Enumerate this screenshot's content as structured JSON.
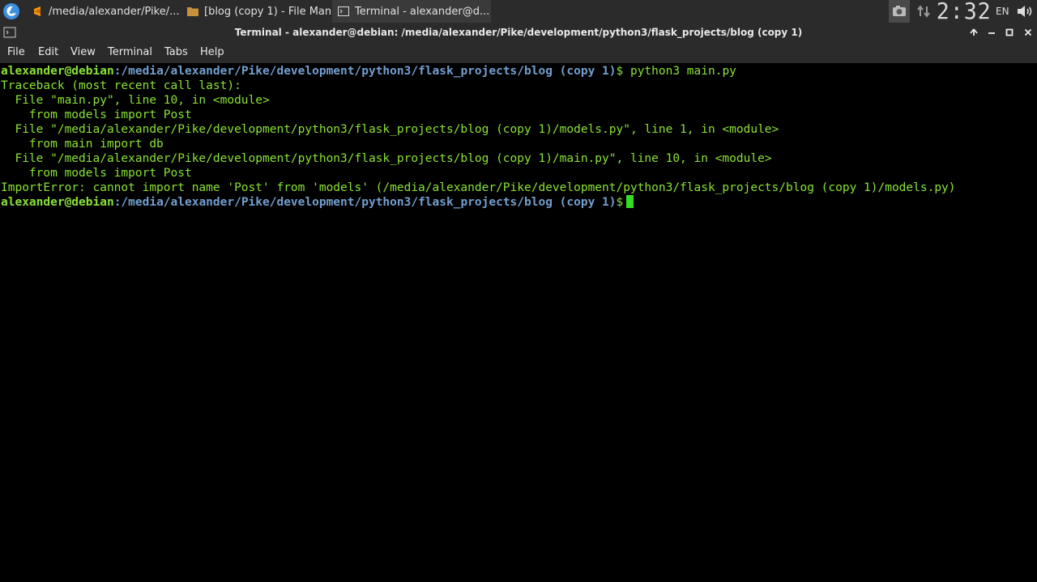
{
  "taskbar": {
    "tasks": [
      {
        "label": "/media/alexander/Pike/...",
        "icon": "sublime-text-icon"
      },
      {
        "label": "[blog (copy 1) - File Man...",
        "icon": "folder-icon"
      },
      {
        "label": "Terminal - alexander@d...",
        "icon": "terminal-icon"
      }
    ],
    "clock": "2:32",
    "language": "EN"
  },
  "window": {
    "title": "Terminal - alexander@debian: /media/alexander/Pike/development/python3/flask_projects/blog (copy 1)"
  },
  "menu": [
    "File",
    "Edit",
    "View",
    "Terminal",
    "Tabs",
    "Help"
  ],
  "terminal": {
    "prompt_user": "alexander@debian",
    "prompt_path": ":/media/alexander/Pike/development/python3/flask_projects/blog (copy 1)",
    "prompt_symbol": "$",
    "command": " python3 main.py",
    "output": [
      "Traceback (most recent call last):",
      "  File \"main.py\", line 10, in <module>",
      "    from models import Post",
      "  File \"/media/alexander/Pike/development/python3/flask_projects/blog (copy 1)/models.py\", line 1, in <module>",
      "    from main import db",
      "  File \"/media/alexander/Pike/development/python3/flask_projects/blog (copy 1)/main.py\", line 10, in <module>",
      "    from models import Post",
      "ImportError: cannot import name 'Post' from 'models' (/media/alexander/Pike/development/python3/flask_projects/blog (copy 1)/models.py)"
    ]
  },
  "colors": {
    "terminal_green": "#8ae234",
    "terminal_blue": "#729fcf",
    "cursor": "#33dd22",
    "panel": "#2b2b2b"
  }
}
